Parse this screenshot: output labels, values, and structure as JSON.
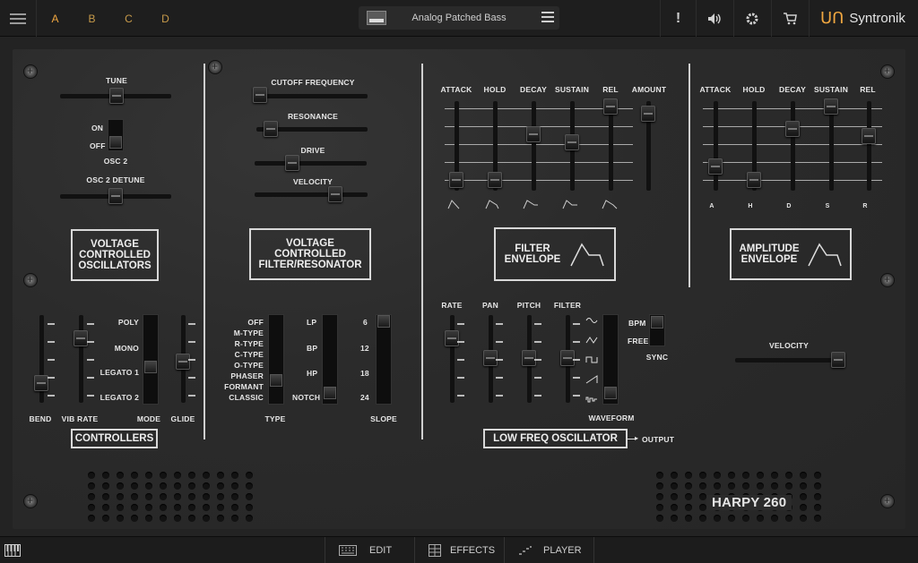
{
  "topbar": {
    "parts": [
      "A",
      "B",
      "C",
      "D"
    ],
    "preset_name": "Analog Patched Bass",
    "alert_icon": "!",
    "brand": "Syntronik"
  },
  "vco": {
    "tune_label": "TUNE",
    "on_label": "ON",
    "off_label": "OFF",
    "osc2_label": "OSC 2",
    "detune_label": "OSC 2 DETUNE",
    "title": "VOLTAGE\nCONTROLLED\nOSCILLATORS"
  },
  "vcf": {
    "cutoff_label": "CUTOFF FREQUENCY",
    "resonance_label": "RESONANCE",
    "drive_label": "DRIVE",
    "velocity_label": "VELOCITY",
    "title": "VOLTAGE\nCONTROLLED\nFILTER/RESONATOR"
  },
  "filter_env": {
    "labels": [
      "ATTACK",
      "HOLD",
      "DECAY",
      "SUSTAIN",
      "REL",
      "AMOUNT"
    ],
    "title": "FILTER\nENVELOPE"
  },
  "amp_env": {
    "labels": [
      "ATTACK",
      "HOLD",
      "DECAY",
      "SUSTAIN",
      "REL"
    ],
    "markers": [
      "A",
      "H",
      "D",
      "S",
      "R"
    ],
    "title": "AMPLITUDE\nENVELOPE",
    "velocity_label": "VELOCITY"
  },
  "controllers": {
    "mode_options": [
      "POLY",
      "MONO",
      "LEGATO 1",
      "LEGATO 2"
    ],
    "bend_label": "BEND",
    "vib_rate_label": "VIB RATE",
    "mode_label": "MODE",
    "glide_label": "GLIDE",
    "title": "CONTROLLERS"
  },
  "filter_type": {
    "types": [
      "OFF",
      "M-TYPE",
      "R-TYPE",
      "C-TYPE",
      "O-TYPE",
      "PHASER",
      "FORMANT",
      "CLASSIC"
    ],
    "type_label": "TYPE",
    "modes": [
      "LP",
      "BP",
      "HP",
      "NOTCH"
    ],
    "slopes": [
      "6",
      "12",
      "18",
      "24"
    ],
    "slope_label": "SLOPE"
  },
  "lfo": {
    "labels": [
      "RATE",
      "PAN",
      "PITCH",
      "FILTER"
    ],
    "bpm_label": "BPM",
    "free_label": "FREE",
    "sync_label": "SYNC",
    "waveform_label": "WAVEFORM",
    "title": "LOW FREQ OSCILLATOR",
    "output_label": "OUTPUT"
  },
  "model_name": "HARPY 260",
  "bottombar": {
    "edit": "EDIT",
    "effects": "EFFECTS",
    "player": "PLAYER"
  }
}
